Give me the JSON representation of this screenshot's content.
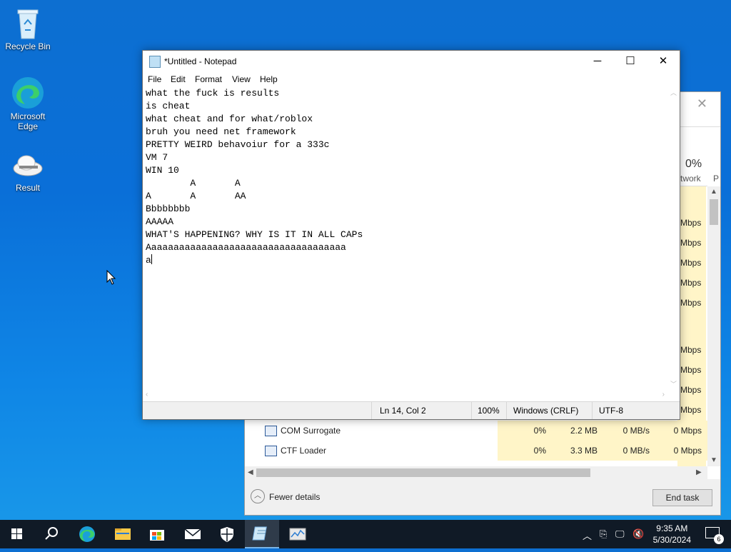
{
  "desktop": {
    "icons": [
      {
        "label": "Recycle Bin",
        "icon": "recycle-bin-icon"
      },
      {
        "label": "Microsoft Edge",
        "icon": "edge-icon"
      },
      {
        "label": "Result",
        "icon": "result-icon"
      }
    ]
  },
  "task_manager": {
    "network_percent": "0%",
    "network_col": "twork",
    "extra_col": "P",
    "network_values": [
      "Mbps",
      "Mbps",
      "Mbps",
      "Mbps",
      "Mbps",
      "Mbps",
      "Mbps",
      "Mbps",
      "Mbps"
    ],
    "processes": [
      {
        "name": "COM Surrogate",
        "cpu": "0%",
        "memory": "2.2 MB",
        "disk": "0 MB/s",
        "network": "0 Mbps"
      },
      {
        "name": "CTF Loader",
        "cpu": "0%",
        "memory": "3.3 MB",
        "disk": "0 MB/s",
        "network": "0 Mbps"
      }
    ],
    "fewer_details": "Fewer details",
    "end_task": "End task"
  },
  "notepad": {
    "title": "*Untitled - Notepad",
    "menu": [
      "File",
      "Edit",
      "Format",
      "View",
      "Help"
    ],
    "lines": [
      "what the fuck is results",
      "is cheat",
      "what cheat and for what/roblox",
      "bruh you need net framework",
      "PRETTY WEIRD behavoiur for a 333c",
      "VM 7",
      "WIN 10",
      "        A       A",
      "A       A       AA",
      "Bbbbbbbb",
      "AAAAA",
      "WHAT'S HAPPENING? WHY IS IT IN ALL CAPs",
      "Aaaaaaaaaaaaaaaaaaaaaaaaaaaaaaaaaaaa",
      "a"
    ],
    "status": {
      "position": "Ln 14, Col 2",
      "zoom": "100%",
      "line_ending": "Windows (CRLF)",
      "encoding": "UTF-8"
    }
  },
  "taskbar": {
    "apps": [
      "start-icon",
      "search-icon",
      "edge-icon",
      "file-explorer-icon",
      "store-icon",
      "mail-icon",
      "security-icon",
      "notepad-icon",
      "taskmanager-icon"
    ],
    "time": "9:35 AM",
    "date": "5/30/2024",
    "notifications": "6"
  }
}
